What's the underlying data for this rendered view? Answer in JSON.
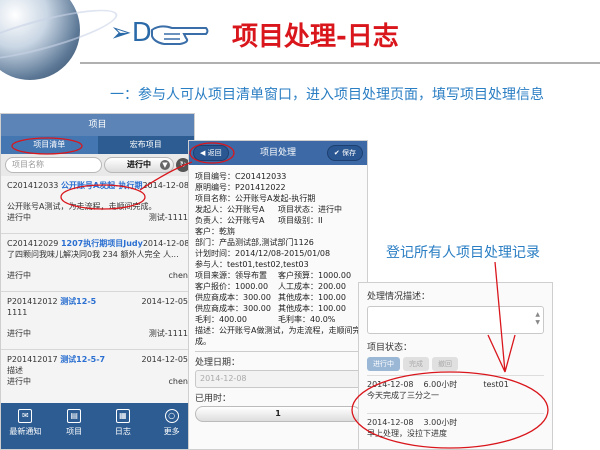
{
  "header": {
    "section_letter": "➢D",
    "title": "项目处理-日志",
    "subtitle": "一：参与人可从项目清单窗口，进入项目处理页面，填写项目处理信息"
  },
  "side_note": "登记所有人项目处理记录",
  "list_screen": {
    "title": "项目",
    "tabs": [
      {
        "label": "项目清单",
        "active": true
      },
      {
        "label": "宏布项目",
        "active": false
      }
    ],
    "search_placeholder": "项目名称",
    "status_select": "进行中",
    "items": [
      {
        "code": "C201412033",
        "name": "公开账号A发起-执行期",
        "date": "2014-12-08",
        "desc": "公开账号A测试，为走流程，走顺间完成。",
        "status": "进行中",
        "owner": "测试-1111"
      },
      {
        "code": "C201412029",
        "name": "1207执行期项目Judy",
        "date": "2014-12-08",
        "desc": "了四颗问我味儿解决同0我 234 额外人完全 人...",
        "status": "进行中",
        "owner": "chen"
      },
      {
        "code": "P201412012",
        "name": "测试12-5",
        "date": "2014-12-05",
        "desc": "1111",
        "status": "进行中",
        "owner": "测试-1111"
      },
      {
        "code": "P201412017",
        "name": "测试12-5-7",
        "date": "2014-12-05",
        "desc": "描述",
        "status": "进行中",
        "owner": "chen"
      }
    ],
    "nav": [
      {
        "label": "最新通知",
        "icon": "chat-icon"
      },
      {
        "label": "项目",
        "icon": "document-icon"
      },
      {
        "label": "日志",
        "icon": "grid-icon"
      },
      {
        "label": "更多",
        "icon": "more-icon"
      }
    ]
  },
  "detail_screen": {
    "back": "返回",
    "title": "项目处理",
    "save": "保存",
    "lines": [
      "项目编号：C201412033",
      "原明编号：P201412022",
      "项目名称：公开账号A发起-执行期"
    ],
    "pairs": [
      [
        "发起人：公开账号A",
        "项目状态：进行中"
      ],
      [
        "负责人：公开账号A",
        "项目级别：II"
      ]
    ],
    "lines2": [
      "客户：乾旃",
      "部门：产品测试部,测试部门1126",
      "计划时间：2014/12/08-2015/01/08",
      "参与人：test01,test02,test03"
    ],
    "pairs2": [
      [
        "项目来源：领导布置",
        "客户预算：1000.00"
      ],
      [
        "客户报价：1000.00",
        "人工成本：200.00"
      ],
      [
        "供应商成本：300.00",
        "其他成本：100.00"
      ],
      [
        "供应商成本：300.00",
        "其他成本：100.00"
      ],
      [
        "毛利：400.00",
        "毛利率：40.0%"
      ]
    ],
    "desc": "描述：公开账号A做测试，为走流程，走顺间完成。",
    "date_label": "处理日期：",
    "date_value": "2014-12-08",
    "hours_label": "已用时：",
    "hours_value": "1"
  },
  "log_screen": {
    "desc_label": "处理情况描述：",
    "status_label": "项目状态：",
    "status_options": [
      "进行中",
      "完成",
      "撤回"
    ],
    "entries": [
      {
        "date": "2014-12-08",
        "hours": "6.00小时",
        "user": "test01",
        "text": "今天完成了三分之一"
      },
      {
        "date": "2014-12-08",
        "hours": "3.00小时",
        "user": "",
        "text": "早上处理，没拉下进度"
      }
    ]
  },
  "colors": {
    "title_red": "#d9161c",
    "accent_blue": "#2a7ec3",
    "nav_blue": "#2d5c92",
    "annotation_red": "#d9161c"
  }
}
